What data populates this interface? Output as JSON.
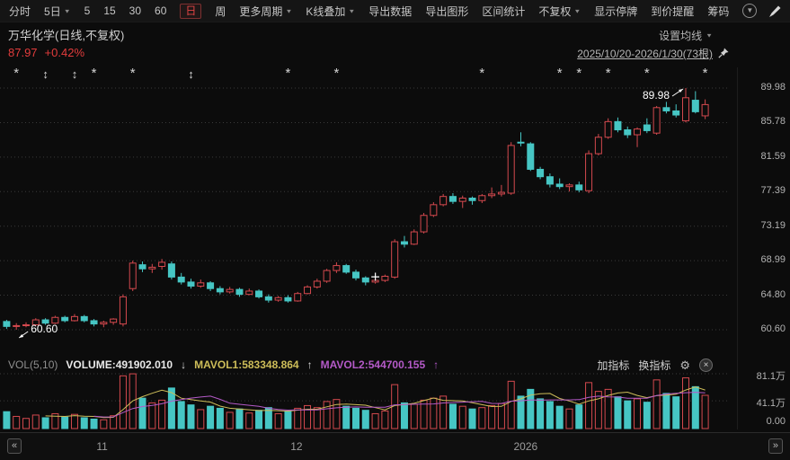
{
  "toolbar": {
    "items": [
      {
        "label": "分时",
        "name": "period-intraday"
      },
      {
        "label": "5日",
        "name": "period-5day",
        "chevron": true
      },
      {
        "label": "5",
        "name": "period-5min"
      },
      {
        "label": "15",
        "name": "period-15min"
      },
      {
        "label": "30",
        "name": "period-30min"
      },
      {
        "label": "60",
        "name": "period-60min"
      },
      {
        "label": "日",
        "name": "period-daily",
        "active": true
      },
      {
        "label": "周",
        "name": "period-weekly"
      },
      {
        "label": "更多周期",
        "name": "more-periods",
        "chevron": true
      },
      {
        "label": "K线叠加",
        "name": "kline-overlay",
        "chevron": true
      },
      {
        "label": "导出数据",
        "name": "export-data"
      },
      {
        "label": "导出图形",
        "name": "export-image"
      },
      {
        "label": "区间统计",
        "name": "range-statistics"
      },
      {
        "label": "不复权",
        "name": "adjustment-mode",
        "chevron": true
      },
      {
        "label": "显示停牌",
        "name": "show-suspended"
      },
      {
        "label": "到价提醒",
        "name": "price-alert"
      },
      {
        "label": "筹码",
        "name": "chip-distribution"
      }
    ]
  },
  "header": {
    "title": "万华化学(日线,不复权)",
    "price": "87.97",
    "change": "+0.42%",
    "ma_settings": "设置均线",
    "date_range": "2025/10/20-2026/1/30(73根)"
  },
  "vol_header": {
    "indicator": "VOL(5,10)",
    "volume": "VOLUME:491902.010",
    "arrow_down": "↓",
    "mavol1": "MAVOL1:583348.864",
    "arrow_up": "↑",
    "mavol2": "MAVOL2:544700.155",
    "arrow_up2": "↑",
    "add_indicator": "加指标",
    "switch_indicator": "换指标"
  },
  "footer": {
    "prev": "«",
    "next": "»",
    "x_labels": [
      {
        "label": "11",
        "bar": 11
      },
      {
        "label": "12",
        "bar": 31
      },
      {
        "label": "2026",
        "bar": 54
      }
    ]
  },
  "chart_data": {
    "type": "candlestick",
    "title": "万华化学 日线 不复权",
    "last_price": 87.97,
    "change_pct": "+0.42%",
    "bar_count": 73,
    "range_label": "2025/10/20-2026/1/30(73根)",
    "y_ticks": [
      "89.98",
      "85.78",
      "81.59",
      "77.39",
      "73.19",
      "68.99",
      "64.80",
      "60.60"
    ],
    "high_annotation": {
      "bar": 71,
      "price": 89.98,
      "label": "89.98"
    },
    "low_annotation": {
      "bar": 2,
      "price": 60.6,
      "label": "60.60"
    },
    "cross_marker": {
      "bar": 39,
      "price": 67.0
    },
    "event_markers": [
      {
        "bar": 2,
        "glyph": "star"
      },
      {
        "bar": 5,
        "glyph": "arrows"
      },
      {
        "bar": 8,
        "glyph": "arrows"
      },
      {
        "bar": 10,
        "glyph": "star"
      },
      {
        "bar": 14,
        "glyph": "star"
      },
      {
        "bar": 20,
        "glyph": "arrows"
      },
      {
        "bar": 30,
        "glyph": "star"
      },
      {
        "bar": 35,
        "glyph": "star"
      },
      {
        "bar": 50,
        "glyph": "star"
      },
      {
        "bar": 58,
        "glyph": "star"
      },
      {
        "bar": 60,
        "glyph": "star"
      },
      {
        "bar": 63,
        "glyph": "star"
      },
      {
        "bar": 67,
        "glyph": "star"
      },
      {
        "bar": 73,
        "glyph": "star"
      }
    ],
    "candles": [
      [
        61.6,
        61.8,
        60.7,
        61.0
      ],
      [
        61.0,
        61.4,
        60.6,
        61.1
      ],
      [
        61.1,
        61.5,
        60.9,
        61.2
      ],
      [
        61.2,
        62.0,
        61.1,
        61.8
      ],
      [
        61.8,
        62.0,
        61.2,
        61.4
      ],
      [
        61.4,
        62.3,
        61.3,
        62.1
      ],
      [
        62.1,
        62.3,
        61.5,
        61.7
      ],
      [
        61.7,
        62.5,
        61.6,
        62.2
      ],
      [
        62.2,
        62.4,
        61.5,
        61.7
      ],
      [
        61.7,
        61.9,
        61.0,
        61.3
      ],
      [
        61.3,
        61.7,
        60.9,
        61.5
      ],
      [
        61.5,
        62.0,
        61.2,
        61.9
      ],
      [
        61.3,
        64.9,
        61.0,
        64.6
      ],
      [
        65.6,
        69.0,
        65.3,
        68.7
      ],
      [
        68.5,
        68.9,
        67.6,
        68.0
      ],
      [
        68.0,
        68.6,
        67.5,
        68.2
      ],
      [
        68.3,
        69.2,
        67.9,
        68.8
      ],
      [
        68.6,
        68.9,
        66.7,
        67.0
      ],
      [
        67.0,
        67.5,
        66.1,
        66.4
      ],
      [
        66.4,
        66.8,
        65.6,
        65.9
      ],
      [
        65.9,
        66.7,
        65.7,
        66.3
      ],
      [
        66.3,
        66.5,
        65.3,
        65.6
      ],
      [
        65.6,
        65.9,
        64.9,
        65.2
      ],
      [
        65.2,
        65.8,
        65.0,
        65.5
      ],
      [
        65.5,
        65.7,
        64.6,
        64.9
      ],
      [
        64.9,
        65.6,
        64.8,
        65.3
      ],
      [
        65.3,
        65.5,
        64.4,
        64.6
      ],
      [
        64.6,
        64.9,
        63.9,
        64.2
      ],
      [
        64.2,
        64.7,
        64.0,
        64.5
      ],
      [
        64.5,
        64.8,
        63.9,
        64.1
      ],
      [
        64.1,
        65.2,
        64.0,
        65.0
      ],
      [
        65.0,
        66.0,
        64.9,
        65.8
      ],
      [
        65.8,
        66.8,
        65.6,
        66.5
      ],
      [
        66.5,
        68.0,
        66.3,
        67.8
      ],
      [
        67.8,
        68.8,
        67.5,
        68.4
      ],
      [
        68.4,
        68.6,
        67.4,
        67.6
      ],
      [
        67.6,
        67.9,
        66.6,
        66.9
      ],
      [
        66.9,
        67.1,
        66.0,
        66.4
      ],
      [
        66.4,
        66.9,
        66.2,
        66.6
      ],
      [
        66.6,
        67.3,
        66.4,
        67.1
      ],
      [
        67.0,
        71.6,
        66.8,
        71.3
      ],
      [
        71.3,
        72.0,
        70.6,
        71.0
      ],
      [
        71.0,
        72.8,
        70.9,
        72.5
      ],
      [
        72.5,
        74.8,
        72.3,
        74.5
      ],
      [
        74.5,
        76.1,
        74.3,
        75.8
      ],
      [
        75.8,
        77.1,
        75.6,
        76.8
      ],
      [
        76.8,
        77.2,
        75.9,
        76.2
      ],
      [
        76.2,
        76.9,
        75.4,
        76.6
      ],
      [
        76.6,
        76.8,
        75.8,
        76.3
      ],
      [
        76.3,
        77.1,
        76.0,
        76.9
      ],
      [
        76.9,
        77.9,
        76.6,
        77.1
      ],
      [
        77.1,
        78.2,
        76.8,
        77.3
      ],
      [
        77.2,
        83.4,
        77.0,
        83.0
      ],
      [
        83.4,
        84.6,
        82.9,
        83.3
      ],
      [
        83.2,
        83.4,
        79.9,
        80.1
      ],
      [
        80.1,
        80.4,
        78.9,
        79.2
      ],
      [
        79.2,
        79.6,
        77.9,
        78.3
      ],
      [
        78.3,
        79.0,
        77.7,
        78.0
      ],
      [
        78.0,
        78.4,
        77.4,
        78.2
      ],
      [
        78.2,
        78.6,
        77.3,
        77.6
      ],
      [
        77.5,
        82.4,
        77.2,
        82.0
      ],
      [
        82.0,
        84.4,
        81.8,
        84.0
      ],
      [
        84.0,
        86.3,
        83.8,
        85.9
      ],
      [
        85.9,
        86.4,
        84.6,
        84.9
      ],
      [
        84.9,
        85.3,
        83.9,
        84.3
      ],
      [
        84.3,
        85.2,
        82.8,
        85.0
      ],
      [
        85.5,
        86.3,
        84.5,
        84.8
      ],
      [
        84.5,
        87.8,
        84.3,
        87.6
      ],
      [
        87.6,
        88.3,
        86.9,
        87.2
      ],
      [
        87.2,
        88.0,
        86.4,
        86.7
      ],
      [
        86.0,
        89.98,
        85.8,
        88.8
      ],
      [
        88.5,
        89.6,
        86.9,
        87.1
      ],
      [
        86.6,
        88.6,
        86.2,
        87.97
      ]
    ],
    "volumes": [
      25,
      18,
      15,
      20,
      16,
      22,
      17,
      21,
      16,
      14,
      13,
      19,
      78,
      81,
      45,
      38,
      42,
      60,
      40,
      35,
      28,
      33,
      30,
      24,
      29,
      23,
      27,
      31,
      22,
      26,
      30,
      34,
      31,
      40,
      43,
      33,
      30,
      27,
      22,
      26,
      65,
      38,
      36,
      42,
      45,
      48,
      36,
      33,
      29,
      31,
      34,
      37,
      70,
      48,
      58,
      44,
      40,
      33,
      29,
      35,
      68,
      55,
      58,
      47,
      41,
      44,
      39,
      72,
      52,
      47,
      75,
      62,
      49.19
    ],
    "vol_max": 81.1,
    "vol_ticks": [
      {
        "label": "81.1万",
        "value": 81.1
      },
      {
        "label": "41.1万",
        "value": 41.1
      },
      {
        "label": "0.00",
        "value": 0
      }
    ],
    "colors": {
      "up": "#d4494e",
      "down": "#46c6c4",
      "mavol1": "#cdbd59",
      "mavol2": "#b45ac8",
      "annotation": "#ffffff",
      "grid": "#3a3a3a"
    }
  }
}
